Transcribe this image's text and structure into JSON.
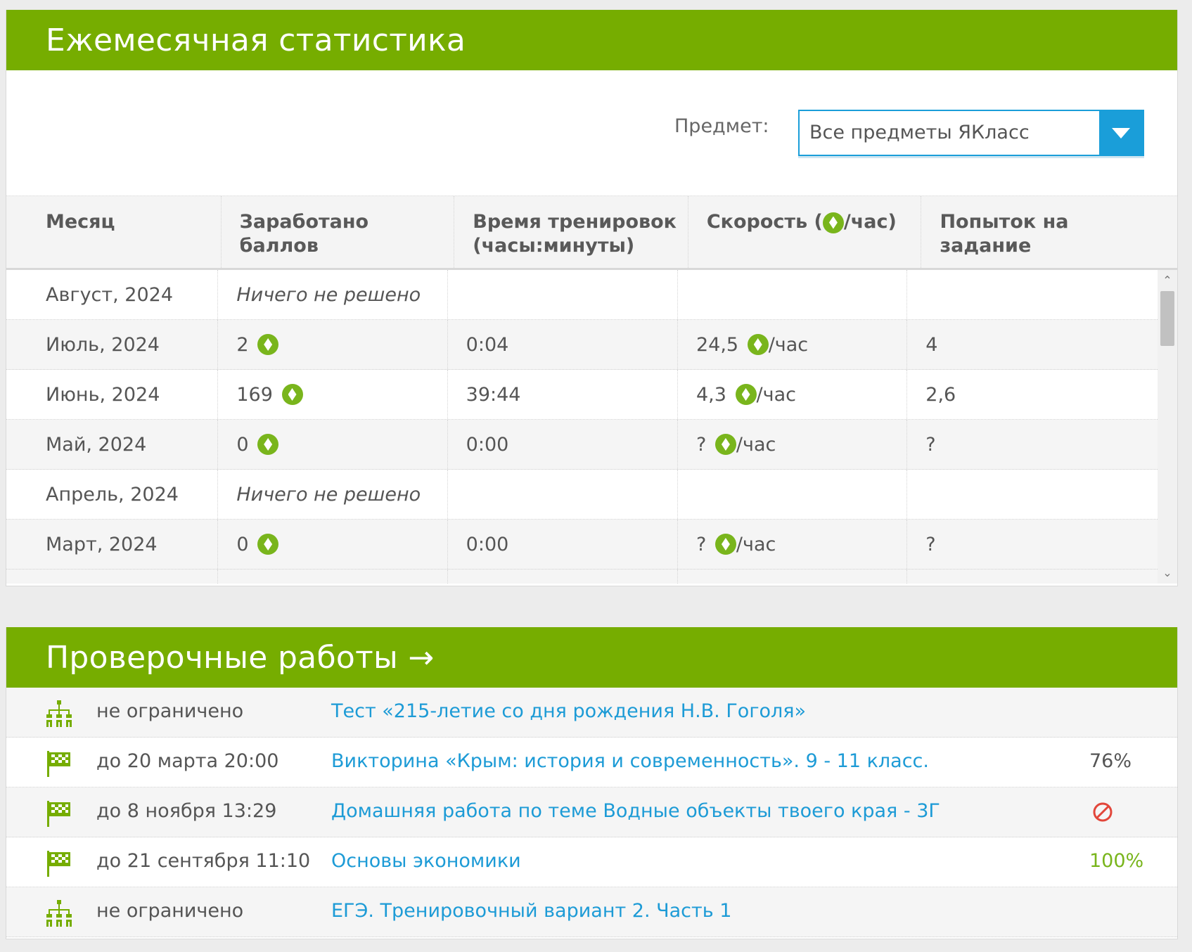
{
  "stats": {
    "title": "Ежемесячная статистика",
    "filter_label": "Предмет:",
    "filter_value": "Все предметы ЯКласс",
    "columns": {
      "month": "Месяц",
      "points": "Заработано баллов",
      "time_line1": "Время тренировок",
      "time_line2": "(часы:минуты)",
      "speed_prefix": "Скорость (",
      "speed_suffix": "/час)",
      "attempts_line1": "Попыток на",
      "attempts_line2": "задание"
    },
    "rows": [
      {
        "month": "Август, 2024",
        "points": "Ничего не решено",
        "time": "",
        "speed": "",
        "speed_unit": "",
        "attempts": "",
        "empty": true
      },
      {
        "month": "Июль, 2024",
        "points": "2",
        "time": "0:04",
        "speed": "24,5",
        "speed_unit": "/час",
        "attempts": "4",
        "empty": false
      },
      {
        "month": "Июнь, 2024",
        "points": "169",
        "time": "39:44",
        "speed": "4,3",
        "speed_unit": "/час",
        "attempts": "2,6",
        "empty": false
      },
      {
        "month": "Май, 2024",
        "points": "0",
        "time": "0:00",
        "speed": "?",
        "speed_unit": "/час",
        "attempts": "?",
        "empty": false
      },
      {
        "month": "Апрель, 2024",
        "points": "Ничего не решено",
        "time": "",
        "speed": "",
        "speed_unit": "",
        "attempts": "",
        "empty": true
      },
      {
        "month": "Март, 2024",
        "points": "0",
        "time": "0:00",
        "speed": "?",
        "speed_unit": "/час",
        "attempts": "?",
        "empty": false
      }
    ],
    "scroll_up": "⌃",
    "scroll_down": "⌄"
  },
  "tests": {
    "title": "Проверочные работы →",
    "items": [
      {
        "icon": "hierarchy-icon",
        "deadline": "не ограничено",
        "title": "Тест «215-летие со дня рождения Н.В. Гоголя»",
        "result": "",
        "result_type": "none"
      },
      {
        "icon": "checkered-flag-icon",
        "deadline": "до 20 марта 20:00",
        "title": "Викторина «Крым: история и современность». 9 - 11 класс.",
        "result": "76%",
        "result_type": "gray"
      },
      {
        "icon": "checkered-flag-icon",
        "deadline": "до 8 ноября 13:29",
        "title": "Домашняя работа по теме Водные объекты твоего края - 3Г",
        "result": "",
        "result_type": "ban"
      },
      {
        "icon": "checkered-flag-icon",
        "deadline": "до 21 сентября 11:10",
        "title": "Основы экономики",
        "result": "100%",
        "result_type": "green"
      },
      {
        "icon": "hierarchy-icon",
        "deadline": "не ограничено",
        "title": "ЕГЭ. Тренировочный вариант 2. Часть 1",
        "result": "",
        "result_type": "none"
      }
    ]
  },
  "colors": {
    "header_green": "#76ad00",
    "link_blue": "#1d9bd6",
    "coin_green": "#79b51c",
    "ban_red": "#e2463a"
  }
}
